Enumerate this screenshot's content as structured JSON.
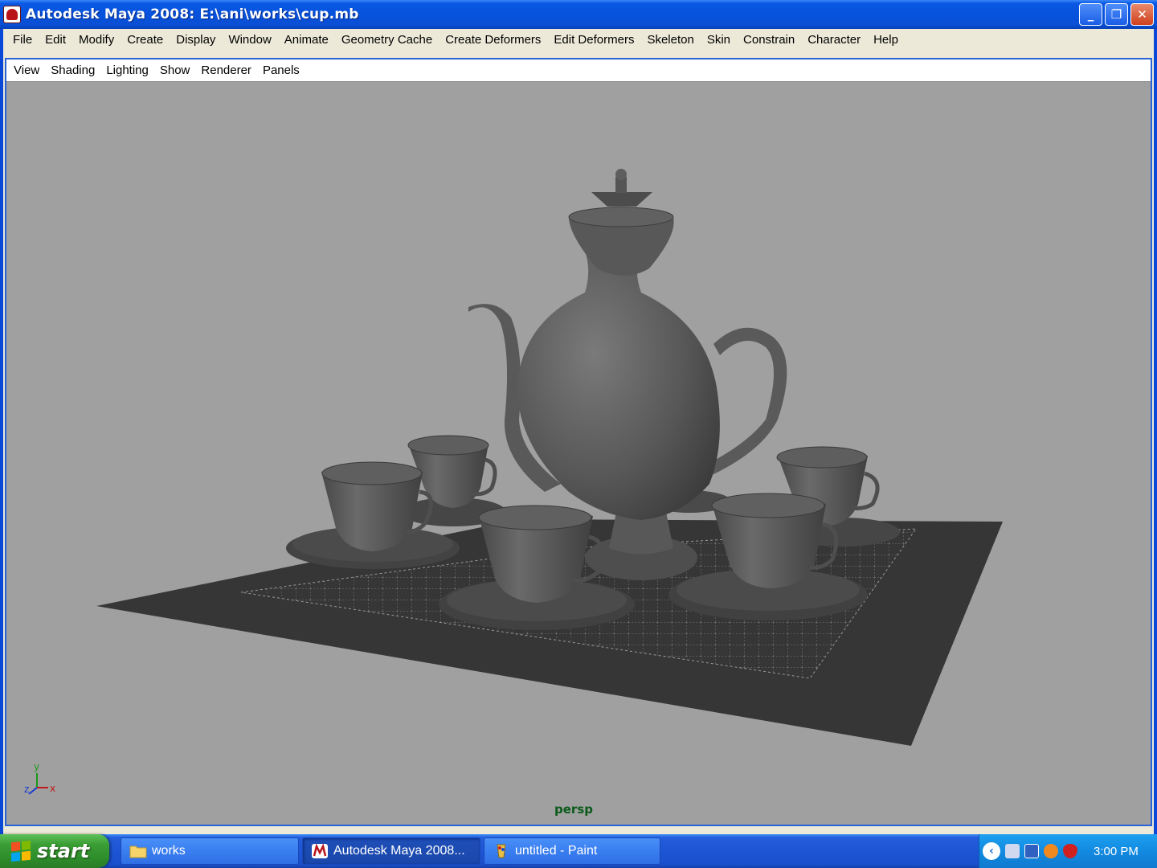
{
  "window": {
    "title": "Autodesk Maya 2008: E:\\ani\\works\\cup.mb",
    "buttons": {
      "minimize": "_",
      "maximize": "❐",
      "close": "✕"
    }
  },
  "menubar": {
    "items": [
      "File",
      "Edit",
      "Modify",
      "Create",
      "Display",
      "Window",
      "Animate",
      "Geometry Cache",
      "Create Deformers",
      "Edit Deformers",
      "Skeleton",
      "Skin",
      "Constrain",
      "Character",
      "Help"
    ]
  },
  "panel": {
    "menu": [
      "View",
      "Shading",
      "Lighting",
      "Show",
      "Renderer",
      "Panels"
    ],
    "camera": "persp",
    "axis": {
      "y": "y",
      "z": "z",
      "x": "x"
    }
  },
  "taskbar": {
    "start_label": "start",
    "tasks": [
      {
        "label": "works",
        "icon": "folder-icon",
        "active": false
      },
      {
        "label": "Autodesk Maya 2008...",
        "icon": "maya-icon",
        "active": true
      },
      {
        "label": "untitled - Paint",
        "icon": "paint-icon",
        "active": false
      }
    ],
    "tray_chevron": "‹",
    "clock": "3:00 PM"
  },
  "colors": {
    "viewport_bg": "#a0a0a0",
    "mesh": "#555555",
    "cloth": "#3a3a3a",
    "titlebar": "#0a58e4",
    "camera_label": "#0a5a1a"
  }
}
